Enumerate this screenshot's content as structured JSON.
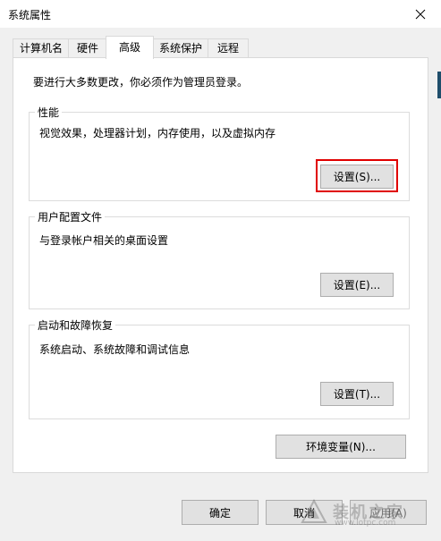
{
  "window": {
    "title": "系统属性"
  },
  "tabs": [
    {
      "label": "计算机名",
      "active": false
    },
    {
      "label": "硬件",
      "active": false
    },
    {
      "label": "高级",
      "active": true
    },
    {
      "label": "系统保护",
      "active": false
    },
    {
      "label": "远程",
      "active": false
    }
  ],
  "advanced": {
    "admin_note": "要进行大多数更改，你必须作为管理员登录。",
    "performance": {
      "title": "性能",
      "desc": "视觉效果，处理器计划，内存使用，以及虚拟内存",
      "button": "设置(S)..."
    },
    "user_profiles": {
      "title": "用户配置文件",
      "desc": "与登录帐户相关的桌面设置",
      "button": "设置(E)..."
    },
    "startup_recovery": {
      "title": "启动和故障恢复",
      "desc": "系统启动、系统故障和调试信息",
      "button": "设置(T)..."
    },
    "env_button": "环境变量(N)..."
  },
  "footer": {
    "ok": "确定",
    "cancel": "取消",
    "apply": "应用(A)"
  },
  "watermark": {
    "brand": "装机之家",
    "url": "www.lotpc.com"
  },
  "colors": {
    "highlight": "#e00000"
  }
}
